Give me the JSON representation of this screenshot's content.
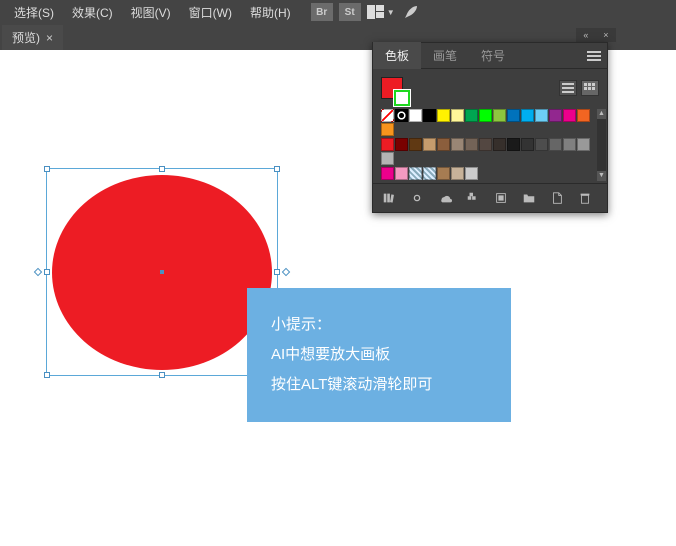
{
  "menubar": {
    "items": [
      "选择(S)",
      "效果(C)",
      "视图(V)",
      "窗口(W)",
      "帮助(H)"
    ],
    "buttons": {
      "br": "Br",
      "st": "St"
    }
  },
  "tabbar": {
    "tab1": {
      "label": "预览)",
      "close": "×"
    }
  },
  "tip": {
    "line1": "小提示：",
    "line2": "AI中想要放大画板",
    "line3": "按住ALT键滚动滑轮即可"
  },
  "panel": {
    "tabs": [
      "色板",
      "画笔",
      "符号"
    ],
    "activeTab": 0,
    "colors": {
      "fill": "#ed1c24",
      "stroke": "#1fd81f"
    },
    "swatches_row1": [
      "none",
      "reg",
      "#ffffff",
      "#000000",
      "#fff200",
      "#fff799",
      "#00a651",
      "#00ff00",
      "#8dc63f",
      "#0072bc",
      "#00aeef",
      "#6dcff6",
      "#92278f",
      "#ec008c",
      "#f26522",
      "#f7941d"
    ],
    "swatches_row2": [
      "#ed1c24",
      "#790000",
      "#603913",
      "#c69c6d",
      "#8b5e3c",
      "#998675",
      "#736357",
      "#534741",
      "#362f2b",
      "#1a1a1a",
      "#333333",
      "#4d4d4d",
      "#666666",
      "#808080",
      "#999999",
      "#b3b3b3"
    ],
    "swatches_row3": [
      "#ec008c",
      "#f49ac1",
      "pattern1",
      "pattern2",
      "#a67c52",
      "#c7b299",
      "#cccccc"
    ]
  },
  "panel_top": {
    "collapse": "«",
    "close": "×"
  }
}
